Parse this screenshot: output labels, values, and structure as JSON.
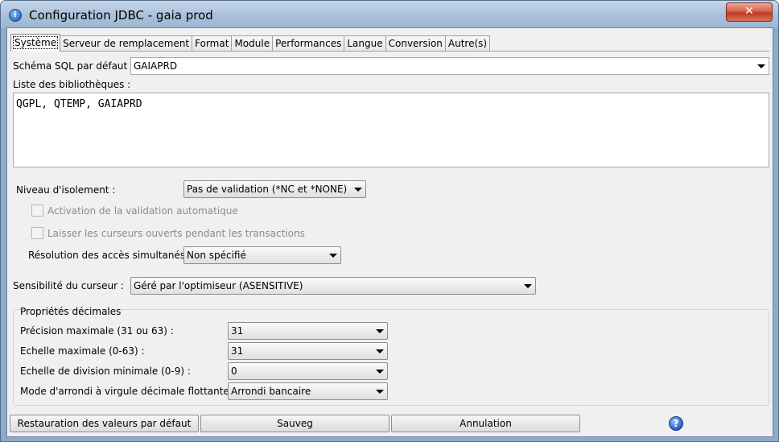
{
  "window": {
    "title": "Configuration JDBC - gaia prod",
    "close_label": "✕"
  },
  "tabs": [
    {
      "label": "Système",
      "active": true
    },
    {
      "label": "Serveur de remplacement"
    },
    {
      "label": "Format"
    },
    {
      "label": "Module"
    },
    {
      "label": "Performances"
    },
    {
      "label": "Langue"
    },
    {
      "label": "Conversion"
    },
    {
      "label": "Autre(s)"
    }
  ],
  "system": {
    "schema_label": "Schéma SQL par défaut :",
    "schema_value": "GAIAPRD",
    "libraries_label": "Liste des bibliothèques :",
    "libraries_value": "QGPL, QTEMP, GAIAPRD",
    "isolation_label": "Niveau d'isolement :",
    "isolation_value": "Pas de validation (*NC et *NONE)",
    "autocommit_label": "Activation de la validation automatique",
    "keep_cursors_label": "Laisser les curseurs ouverts pendant les transactions",
    "concurrent_label": "Résolution des accès simultanés :",
    "concurrent_value": "Non spécifié",
    "cursor_sensitivity_label": "Sensibilité du curseur :",
    "cursor_sensitivity_value": "Géré par l'optimiseur (ASENSITIVE)"
  },
  "decimal": {
    "group_label": "Propriétés décimales",
    "max_precision_label": "Précision maximale (31 ou 63) :",
    "max_precision_value": "31",
    "max_scale_label": "Echelle maximale (0-63) :",
    "max_scale_value": "31",
    "min_div_scale_label": "Echelle de division minimale (0-9) :",
    "min_div_scale_value": "0",
    "rounding_label": "Mode d'arrondi à virgule décimale flottante :",
    "rounding_value": "Arrondi bancaire"
  },
  "footer": {
    "restore_label": "Restauration des valeurs par défaut",
    "save_label": "Sauveg",
    "cancel_label": "Annulation",
    "help_glyph": "?"
  },
  "colors": {
    "title_bar": "#aac0da",
    "close_button": "#c1381f",
    "dialog_bg": "#f0f0f0"
  }
}
